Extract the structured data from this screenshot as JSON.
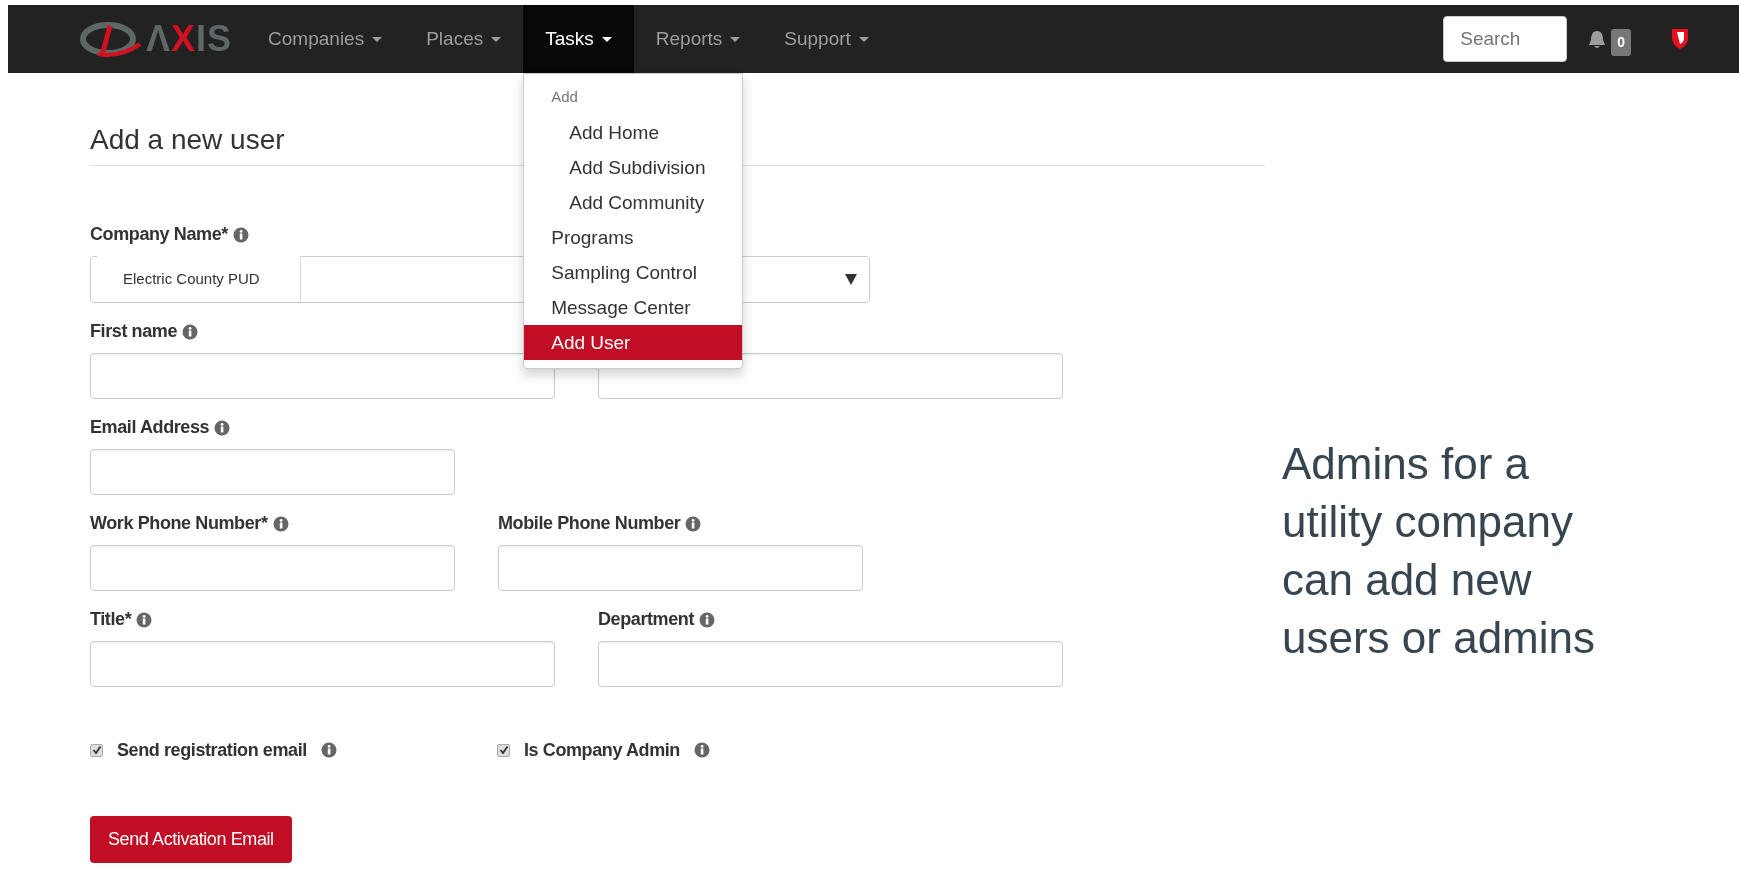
{
  "navbar": {
    "logo": "ΛXIS",
    "menus": [
      {
        "label": "Companies",
        "selected": false
      },
      {
        "label": "Places",
        "selected": false
      },
      {
        "label": "Tasks",
        "selected": true
      },
      {
        "label": "Reports",
        "selected": false
      },
      {
        "label": "Support",
        "selected": false
      }
    ],
    "search": {
      "placeholder": "Search"
    },
    "notifications": {
      "count": "0"
    }
  },
  "tasks_menu": {
    "header": "Add",
    "items": [
      {
        "label": "Add Home",
        "indented": true,
        "selected": false
      },
      {
        "label": "Add Subdivision",
        "indented": true,
        "selected": false
      },
      {
        "label": "Add Community",
        "indented": true,
        "selected": false
      },
      {
        "label": "Programs",
        "indented": false,
        "selected": false
      },
      {
        "label": "Sampling Control",
        "indented": false,
        "selected": false
      },
      {
        "label": "Message Center",
        "indented": false,
        "selected": false
      },
      {
        "label": "Add User",
        "indented": false,
        "selected": true
      }
    ]
  },
  "form": {
    "title": "Add a new user",
    "rows": [
      [
        {
          "kind": "select",
          "label": "Company Name*",
          "value": "Electric County PUD"
        }
      ],
      [
        {
          "kind": "text",
          "label": "First name"
        },
        {
          "kind": "text"
        }
      ],
      [
        {
          "kind": "text",
          "label": "Email Address"
        }
      ],
      [
        {
          "kind": "text",
          "label": "Work Phone Number*"
        },
        {
          "kind": "text",
          "label": "Mobile Phone Number"
        }
      ],
      [
        {
          "kind": "text",
          "label": "Title*"
        },
        {
          "kind": "text",
          "label": "Department"
        }
      ]
    ],
    "checkboxes": [
      {
        "label": "Send registration email",
        "checked": true
      },
      {
        "label": "Is Company Admin",
        "checked": true
      }
    ],
    "submit": "Send Activation Email"
  },
  "callout": "Admins for a utility company can add new users or admins"
}
